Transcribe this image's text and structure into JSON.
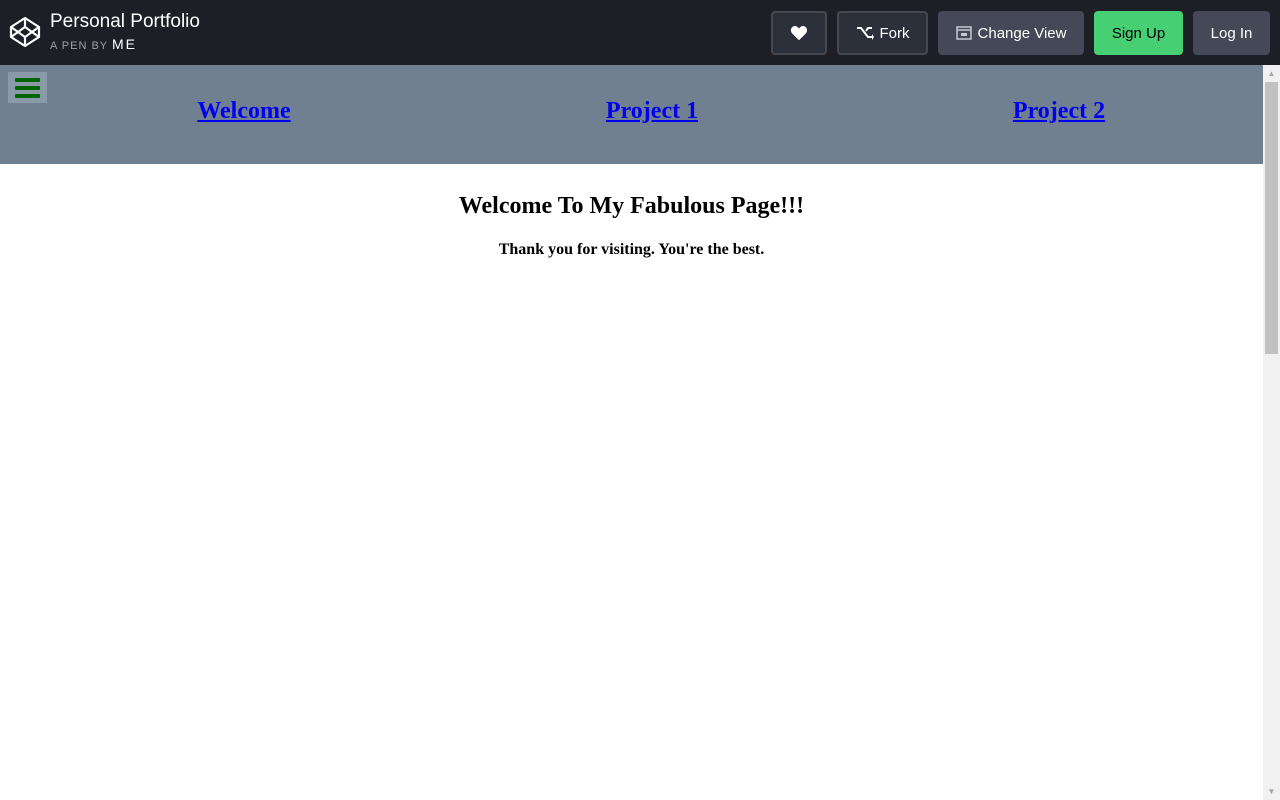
{
  "header": {
    "title": "Personal Portfolio",
    "by_prefix": "A PEN BY",
    "author": "ME",
    "buttons": {
      "fork": "Fork",
      "change_view": "Change View",
      "sign_up": "Sign Up",
      "log_in": "Log In"
    },
    "icons": {
      "logo": "codepen-logo-icon",
      "heart": "heart-icon",
      "fork": "fork-icon",
      "change_view": "change-view-icon"
    },
    "colors": {
      "bar_bg": "#1e1f26",
      "sign_up_bg": "#47cf73",
      "button_bg": "#444857"
    }
  },
  "preview": {
    "nav": {
      "links": [
        "Welcome",
        "Project 1",
        "Project 2"
      ],
      "menu_icon": "hamburger-menu-icon",
      "bg_color": "#708090",
      "menu_icon_color": "#006400",
      "link_color": "#0000ee"
    },
    "heading": "Welcome To My Fabulous Page!!!",
    "subheading": "Thank you for visiting. You're the best."
  }
}
